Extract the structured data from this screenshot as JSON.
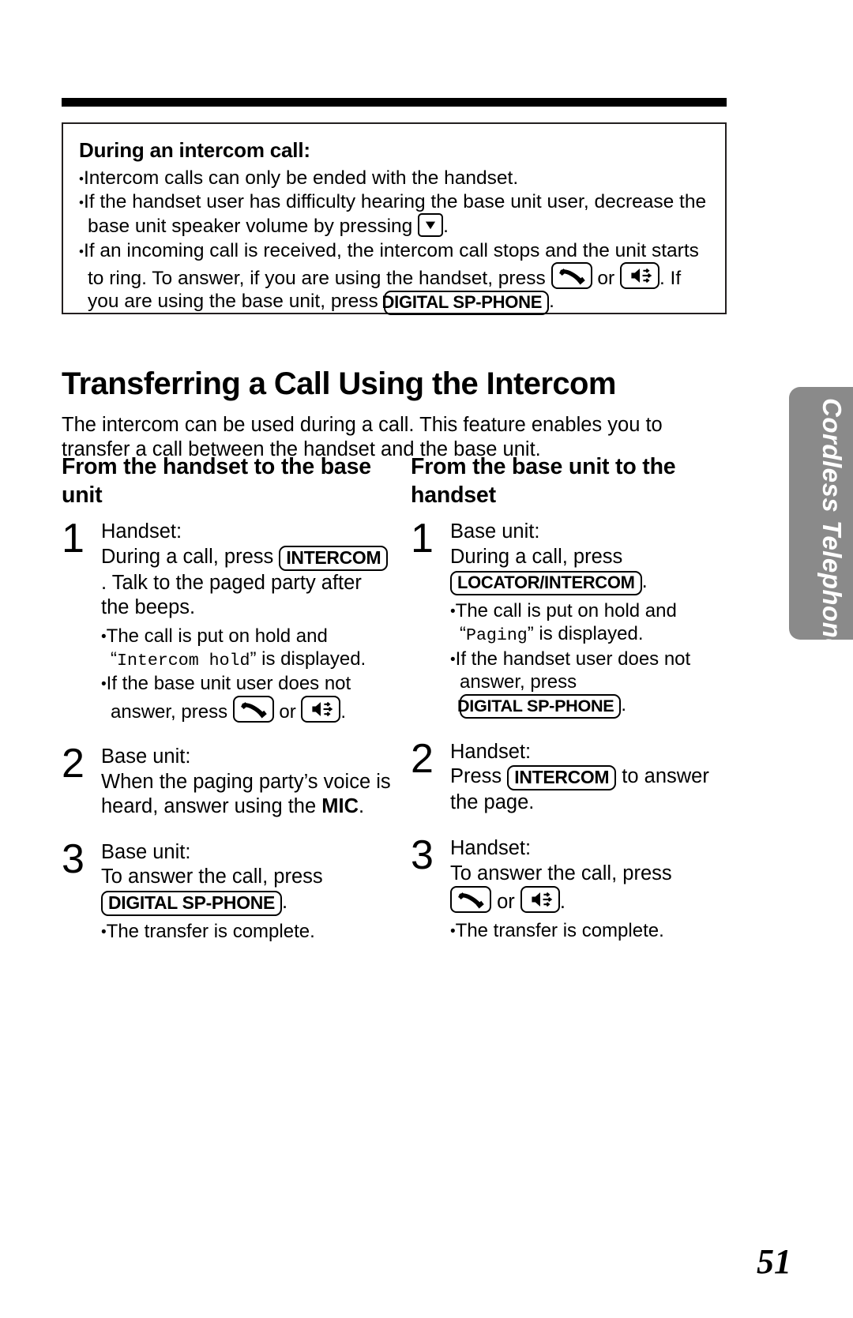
{
  "page": {
    "number": "51",
    "side_tab_label": "Cordless Telephone"
  },
  "note_box": {
    "title": "During an intercom call:",
    "bullets": [
      {
        "id": "note-bullet-1",
        "parts": [
          {
            "type": "text",
            "value": "Intercom calls can only be ended with the handset."
          }
        ]
      },
      {
        "id": "note-bullet-2",
        "parts": [
          {
            "type": "text",
            "value": "If the handset user has difficulty hearing the base unit user, decrease the base unit speaker volume by pressing "
          },
          {
            "type": "icon",
            "value": "volume-down-key-icon"
          },
          {
            "type": "text",
            "value": "."
          }
        ]
      },
      {
        "id": "note-bullet-3",
        "parts": [
          {
            "type": "text",
            "value": "If an incoming call is received, the intercom call stops and the unit starts to ring. To answer, if you are using the handset, press "
          },
          {
            "type": "icon",
            "value": "talk-key-icon"
          },
          {
            "type": "text",
            "value": " or "
          },
          {
            "type": "icon",
            "value": "speakerphone-key-icon"
          },
          {
            "type": "text",
            "value": ". If you are using the base unit, press "
          },
          {
            "type": "key",
            "value": "DIGITAL SP-PHONE"
          },
          {
            "type": "text",
            "value": "."
          }
        ]
      }
    ]
  },
  "heading": "Transferring a Call Using the Intercom",
  "intro": "The intercom can be used during a call. This feature enables you to transfer a call between the handset and the base unit.",
  "columns": [
    {
      "id": "from-handset-to-base-unit",
      "title": "From the handset to the base unit",
      "steps": [
        {
          "number": "1",
          "lines": [
            "Handset:",
            "During a call, press"
          ],
          "key_label": "INTERCOM",
          "after_key": ". Talk to the paged party after the beeps.",
          "bullets": [
            {
              "id": "b1",
              "prefix": "The call is put on hold and ",
              "display": "Intercom hold",
              "suffix": " is displayed.",
              "icons": []
            },
            {
              "id": "b2",
              "prefix": "If the base unit user does not answer, press ",
              "display": "",
              "suffix": ".",
              "icons": [
                "talk-key-icon",
                "speakerphone-key-icon"
              ],
              "between_icons": " or "
            }
          ]
        },
        {
          "number": "2",
          "lines": [
            "Base unit:",
            "When the paging party’s voice is heard, answer using the"
          ],
          "bold_word": "MIC",
          "bold_suffix": ".",
          "bullets": []
        },
        {
          "number": "3",
          "lines": [
            "Base unit:",
            "To answer the call, press"
          ],
          "key_label": "DIGITAL SP-PHONE",
          "after_key": ".",
          "bullets": [
            {
              "id": "b3",
              "prefix": "The transfer is complete.",
              "display": "",
              "suffix": "",
              "icons": []
            }
          ]
        }
      ]
    },
    {
      "id": "from-base-unit-to-handset",
      "title": "From the base unit to the handset",
      "steps": [
        {
          "number": "1",
          "lines": [
            "Base unit:",
            "During a call, press"
          ],
          "key_label": "LOCATOR/INTERCOM",
          "after_key": ".",
          "bullets": [
            {
              "id": "rb1",
              "prefix": "The call is put on hold and ",
              "display": "Paging",
              "suffix": " is displayed.",
              "icons": []
            },
            {
              "id": "rb2",
              "prefix": "If the handset user does not answer, press ",
              "display": "",
              "suffix": ".",
              "icons": [],
              "key_label": "DIGITAL SP-PHONE"
            }
          ]
        },
        {
          "number": "2",
          "lines": [
            "Handset:"
          ],
          "press_prefix": "Press ",
          "key_label": "INTERCOM",
          "after_key": " to answer the page.",
          "bullets": []
        },
        {
          "number": "3",
          "lines": [
            "Handset:",
            "To answer the call, press"
          ],
          "icons": [
            "talk-key-icon",
            "speakerphone-key-icon"
          ],
          "between_icons": " or ",
          "after_icons": ".",
          "bullets": [
            {
              "id": "rb3",
              "prefix": "The transfer is complete.",
              "display": "",
              "suffix": "",
              "icons": []
            }
          ]
        }
      ]
    }
  ],
  "icons": {
    "bullet": "•",
    "volume_down": "▼"
  }
}
